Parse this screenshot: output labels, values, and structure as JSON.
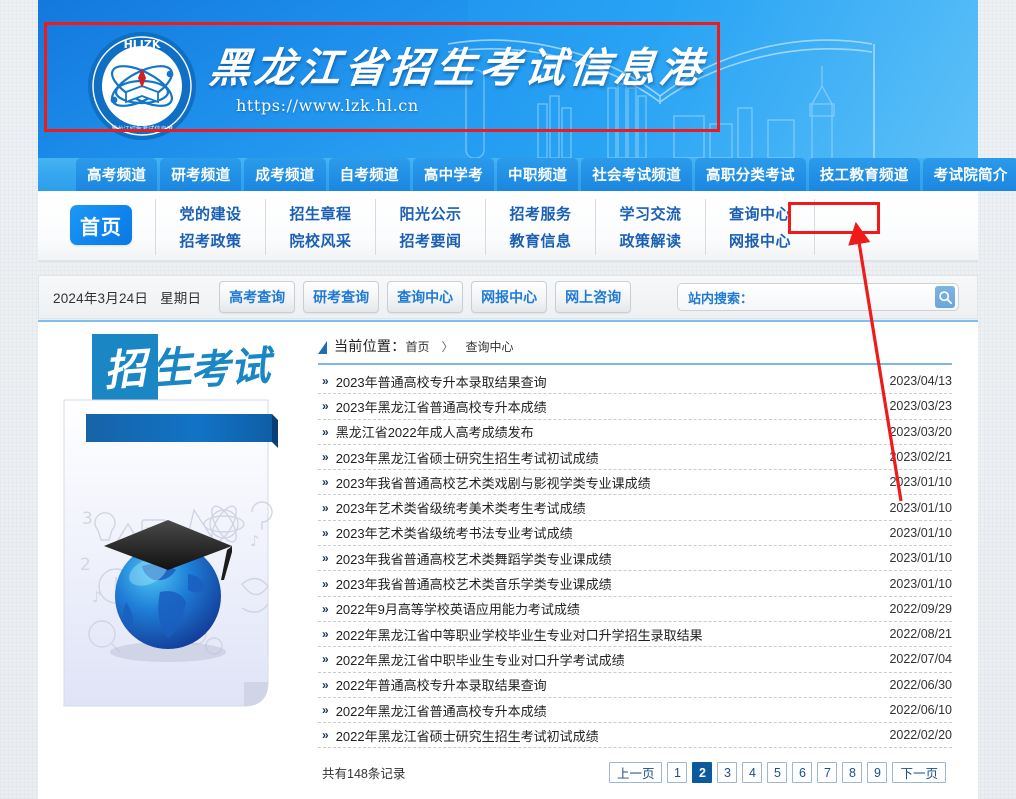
{
  "site": {
    "logo_initials": "HLJZK",
    "logo_ring_text": "黑龙江招生考试信息港",
    "title": "黑龙江省招生考试信息港",
    "url": "https://www.lzk.hl.cn"
  },
  "tabs": [
    {
      "label": "高考频道"
    },
    {
      "label": "研考频道"
    },
    {
      "label": "成考频道"
    },
    {
      "label": "自考频道"
    },
    {
      "label": "高中学考"
    },
    {
      "label": "中职频道"
    },
    {
      "label": "社会考试频道"
    },
    {
      "label": "高职分类考试"
    },
    {
      "label": "技工教育频道"
    },
    {
      "label": "考试院简介"
    }
  ],
  "mainnav": {
    "home_label": "首页",
    "columns": [
      {
        "top": "党的建设",
        "bottom": "招考政策"
      },
      {
        "top": "招生章程",
        "bottom": "院校风采"
      },
      {
        "top": "阳光公示",
        "bottom": "招考要闻"
      },
      {
        "top": "招考服务",
        "bottom": "教育信息"
      },
      {
        "top": "学习交流",
        "bottom": "政策解读"
      },
      {
        "top": "查询中心",
        "bottom": "网报中心"
      }
    ]
  },
  "toolbar": {
    "date": "2024年3月24日",
    "weekday": "星期日",
    "quick_links": [
      {
        "label": "高考查询"
      },
      {
        "label": "研考查询"
      },
      {
        "label": "查询中心"
      },
      {
        "label": "网报中心"
      },
      {
        "label": "网上咨询"
      }
    ],
    "search_label": "站内搜索：",
    "search_value": "",
    "search_placeholder": "",
    "search_icon": "search-icon"
  },
  "sidebar": {
    "banner_title": "招生考试",
    "illustration": "graduation-cap-globe"
  },
  "breadcrumb": {
    "label": "当前位置：",
    "items": [
      "首页",
      "查询中心"
    ],
    "separator": "〉"
  },
  "news": {
    "rows": [
      {
        "title": "2023年普通高校专升本录取结果查询",
        "date": "2023/04/13"
      },
      {
        "title": "2023年黑龙江省普通高校专升本成绩",
        "date": "2023/03/23"
      },
      {
        "title": "黑龙江省2022年成人高考成绩发布",
        "date": "2023/03/20"
      },
      {
        "title": "2023年黑龙江省硕士研究生招生考试初试成绩",
        "date": "2023/02/21"
      },
      {
        "title": "2023年我省普通高校艺术类戏剧与影视学类专业课成绩",
        "date": "2023/01/10"
      },
      {
        "title": "2023年艺术类省级统考美术类考生考试成绩",
        "date": "2023/01/10"
      },
      {
        "title": "2023年艺术类省级统考书法专业考试成绩",
        "date": "2023/01/10"
      },
      {
        "title": "2023年我省普通高校艺术类舞蹈学类专业课成绩",
        "date": "2023/01/10"
      },
      {
        "title": "2023年我省普通高校艺术类音乐学类专业课成绩",
        "date": "2023/01/10"
      },
      {
        "title": "2022年9月高等学校英语应用能力考试成绩",
        "date": "2022/09/29"
      },
      {
        "title": "2022年黑龙江省中等职业学校毕业生专业对口升学招生录取结果",
        "date": "2022/08/21"
      },
      {
        "title": "2022年黑龙江省中职毕业生专业对口升学考试成绩",
        "date": "2022/07/04"
      },
      {
        "title": "2022年普通高校专升本录取结果查询",
        "date": "2022/06/30"
      },
      {
        "title": "2022年黑龙江省普通高校专升本成绩",
        "date": "2022/06/10"
      },
      {
        "title": "2022年黑龙江省硕士研究生招生考试初试成绩",
        "date": "2022/02/20"
      }
    ]
  },
  "pagination": {
    "record_text": "共有148条记录",
    "prev_label": "上一页",
    "next_label": "下一页",
    "pages": [
      "1",
      "2",
      "3",
      "4",
      "5",
      "6",
      "7",
      "8",
      "9"
    ],
    "active_page": "2"
  },
  "annotations": {
    "highlight_color": "#ef1b1b",
    "header_box": "banner-highlight",
    "target_box": "query-center-highlight",
    "arrow": "pointer-arrow-to-query-center"
  },
  "colors": {
    "brand_blue": "#1b86e8",
    "nav_link": "#1a5fb4",
    "active_page": "#0a5a9c",
    "annotation_red": "#ef1b1b"
  }
}
